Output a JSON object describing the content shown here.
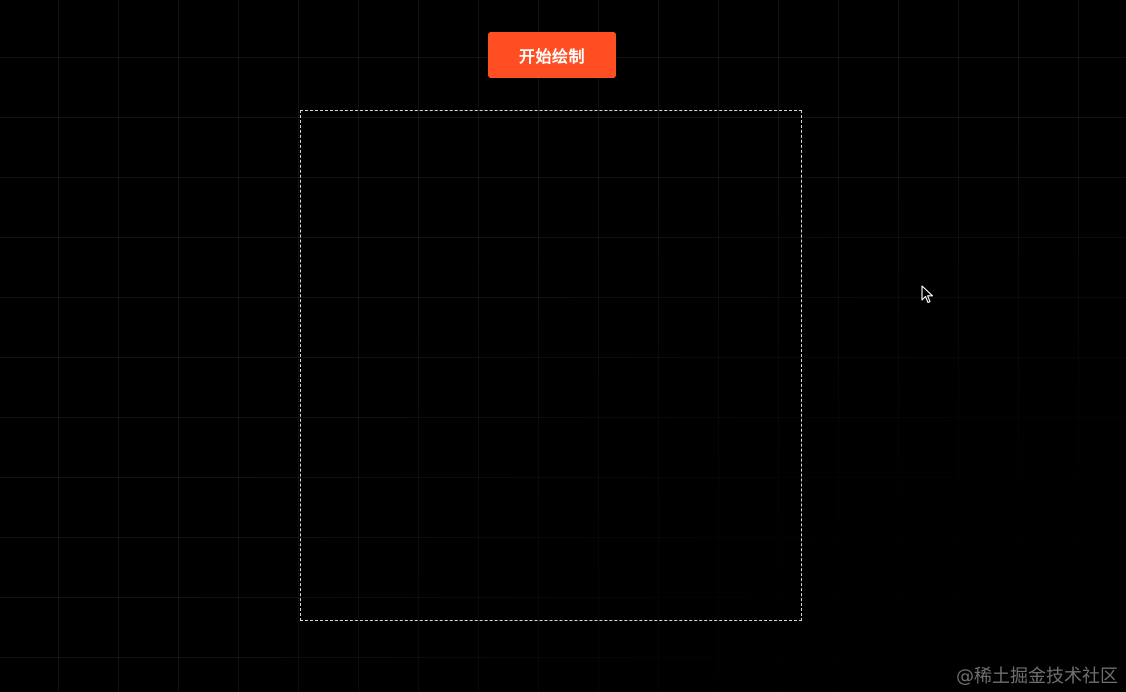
{
  "toolbar": {
    "start_draw_label": "开始绘制"
  },
  "colors": {
    "accent": "#ff4f22",
    "background": "#000000",
    "grid_line": "#1a1a1a",
    "canvas_border": "#d9d9d9",
    "watermark": "#9a9a9a"
  },
  "cursor": {
    "icon": "arrow-pointer-icon"
  },
  "watermark": {
    "text": "@稀土掘金技术社区"
  }
}
